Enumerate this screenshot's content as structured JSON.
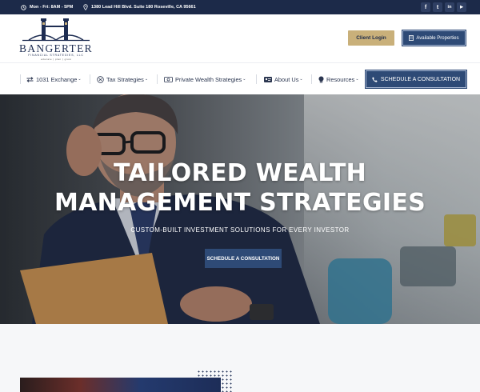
{
  "topbar": {
    "hours": "Mon - Fri: 8AM - 5PM",
    "address": "1380 Lead Hill Blvd. Suite 180 Roseville, CA 95661",
    "social": [
      {
        "icon": "facebook-icon",
        "glyph": "f"
      },
      {
        "icon": "twitter-icon",
        "glyph": "t"
      },
      {
        "icon": "linkedin-icon",
        "glyph": "in"
      },
      {
        "icon": "youtube-icon",
        "glyph": "▶"
      }
    ]
  },
  "header": {
    "logo_word": "BANGERTER",
    "logo_sub": "FINANCIAL STRATEGIES, LLC",
    "logo_tag": "educate | plan | grow",
    "client_login": "Client Login",
    "available_properties": "Available Properties"
  },
  "nav": {
    "items": [
      {
        "label": "1031 Exchange",
        "icon": "exchange-icon"
      },
      {
        "label": "Tax Strategies",
        "icon": "tax-icon"
      },
      {
        "label": "Private Wealth Strategies",
        "icon": "money-icon"
      },
      {
        "label": "About Us",
        "icon": "id-card-icon"
      },
      {
        "label": "Resources",
        "icon": "lightbulb-icon"
      }
    ],
    "schedule_button": "SCHEDULE A CONSULTATION"
  },
  "hero": {
    "title_line1": "TAILORED WEALTH",
    "title_line2": "MANAGEMENT STRATEGIES",
    "subtitle": "CUSTOM-BUILT INVESTMENT SOLUTIONS FOR EVERY INVESTOR",
    "button": "SCHEDULE A CONSULTATION"
  },
  "colors": {
    "navy": "#1c2a49",
    "button_blue": "#2e4a76",
    "gold": "#c9b07a"
  }
}
